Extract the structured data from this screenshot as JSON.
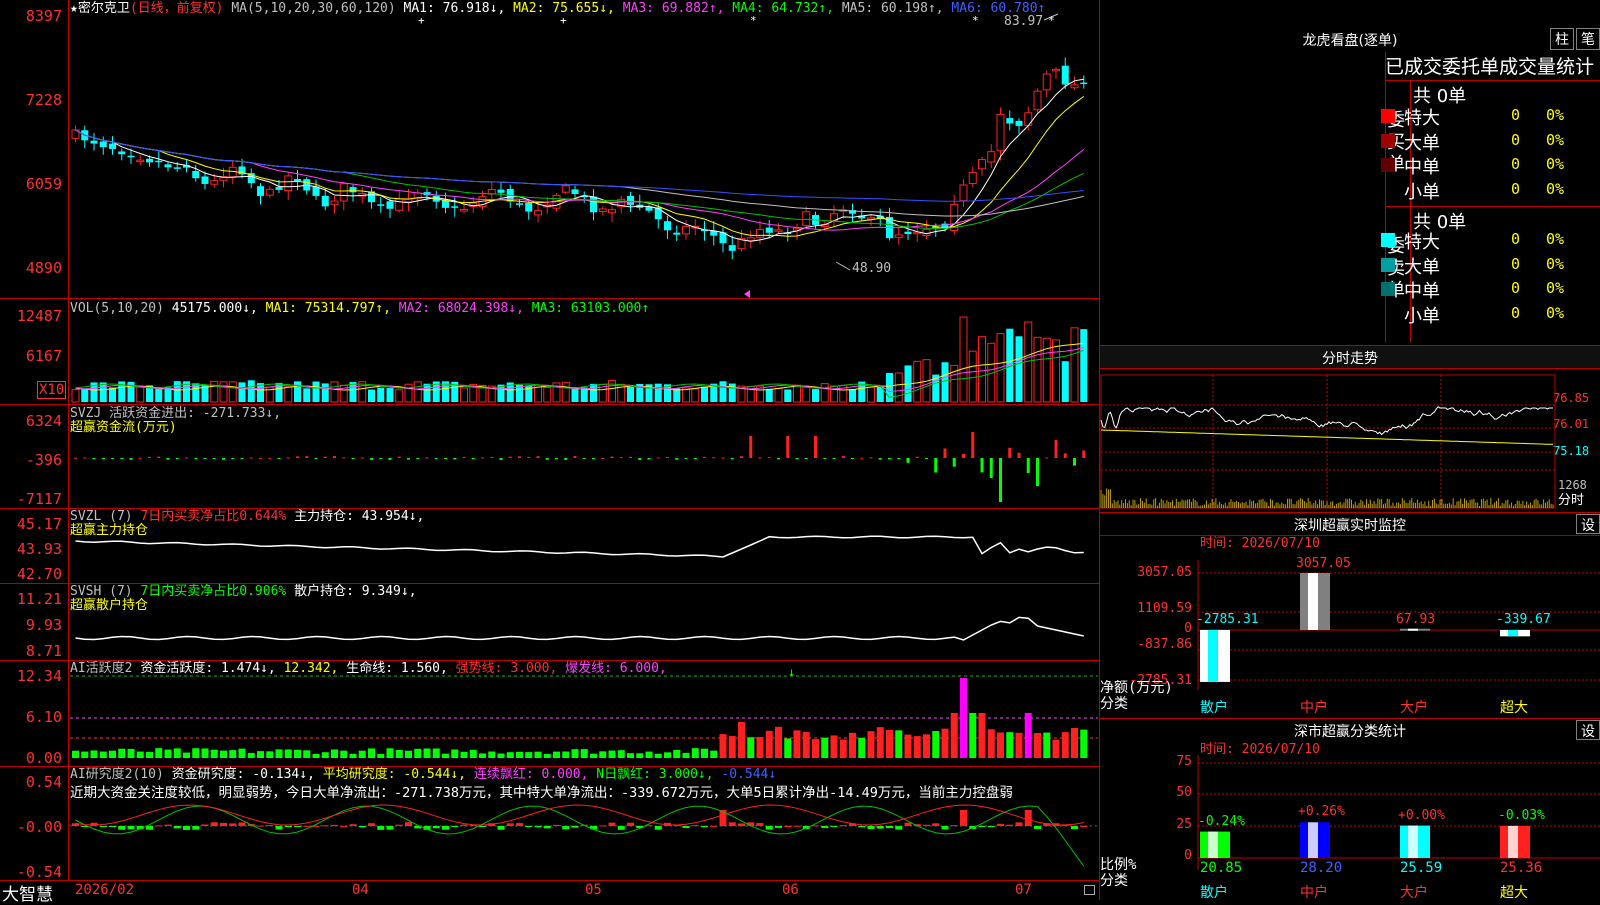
{
  "main": {
    "title_star": "★",
    "stock_name": "密尔克卫",
    "period": "(日线，前复权)",
    "ma_header": "MA(5,10,20,30,60,120)",
    "ma1": "MA1: 76.918↓,",
    "ma2": "MA2: 75.655↓,",
    "ma3": "MA3: 69.882↑,",
    "ma4": "MA4: 64.732↑,",
    "ma5": "MA5: 60.198↑,",
    "ma6": "MA6: 60.780↑",
    "price_axis": [
      "8397",
      "7228",
      "6059",
      "4890"
    ],
    "high_label": "83.97",
    "low_label": "48.90"
  },
  "vol": {
    "header": "VOL(5,10,20)",
    "v": "45175.000↓,",
    "ma1": "MA1: 75314.797↑,",
    "ma2": "MA2: 68024.398↓,",
    "ma3": "MA3: 63103.000↑",
    "axis": [
      "12487",
      "6167"
    ],
    "unit": "X10"
  },
  "svzj": {
    "header": "SVZJ  活跃资金进出: -271.733↓,",
    "sub": "超赢资金流(万元)",
    "axis": [
      "6324",
      "-396",
      "-7117"
    ]
  },
  "svzl": {
    "header1": "SVZL (7)",
    "header2": "7日内买卖净占比0.644%",
    "header3": "主力持仓: 43.954↓,",
    "sub": "超赢主力持仓",
    "axis": [
      "45.17",
      "43.93",
      "42.70"
    ]
  },
  "svsh": {
    "header1": "SVSH (7)",
    "header2": "7日内买卖净占比0.906%",
    "header3": "散户持仓: 9.349↓,",
    "sub": "超赢散户持仓",
    "axis": [
      "11.21",
      "9.93",
      "8.71"
    ]
  },
  "ai1": {
    "header1": "AI活跃度2",
    "header2": "资金活跃度: 1.474↓,",
    "header3": "12.342,",
    "header4": "生命线: 1.560,",
    "header5": "强势线: 3.000,",
    "header6": "爆发线: 6.000,",
    "axis": [
      "12.34",
      "6.10",
      "0.00"
    ]
  },
  "ai2": {
    "header1": "AI研究度2(10)",
    "header2": "资金研究度: -0.134↓,",
    "header3": "平均研究度: -0.544↓,",
    "header4": "连续飘红: 0.000,",
    "header5": "N日飘红: 3.000↓,",
    "header6": "-0.544↓",
    "comment": "近期大资金关注度较低，明显弱势，今日大单净流出：-271.738万元，其中特大单净流出：-339.672万元，大单5日累计净出-14.49万元，当前主力控盘弱",
    "axis": [
      "0.54",
      "-0.00",
      "-0.54"
    ]
  },
  "bottom": {
    "brand": "大智慧",
    "dates": [
      "2026/02",
      "04",
      "05",
      "06",
      "07"
    ]
  },
  "right": {
    "dragon_title": "龙虎看盘(逐单)",
    "btn_zhu": "柱",
    "btn_bi": "笔",
    "stats_title": "已成交委托单成交量统计",
    "buy_label": "委买单",
    "sell_label": "委卖单",
    "buy_total": "共 0单",
    "sell_total": "共 0单",
    "buy_rows": [
      {
        "name": "特大",
        "count": "0",
        "pct": "0%",
        "color": "#ff0000"
      },
      {
        "name": "大单",
        "count": "0",
        "pct": "0%",
        "color": "#a00000"
      },
      {
        "name": "中单",
        "count": "0",
        "pct": "0%",
        "color": "#600000"
      },
      {
        "name": "小单",
        "count": "0",
        "pct": "0%",
        "color": ""
      }
    ],
    "sell_rows": [
      {
        "name": "特大",
        "count": "0",
        "pct": "0%",
        "color": "#00ffff"
      },
      {
        "name": "大单",
        "count": "0",
        "pct": "0%",
        "color": "#00a0a0"
      },
      {
        "name": "中单",
        "count": "0",
        "pct": "0%",
        "color": "#007070"
      },
      {
        "name": "小单",
        "count": "0",
        "pct": "0%",
        "color": ""
      }
    ],
    "intraday_title": "分时走势",
    "intraday_axis": [
      "76.85",
      "76.01",
      "75.18"
    ],
    "intraday_vol": "1268",
    "intraday_unit": "分时",
    "monitor_title": "深圳超赢实时监控",
    "monitor_btn": "设",
    "monitor_time": "时间: 2026/07/10",
    "monitor_axis": [
      "3057.05",
      "1109.59",
      "0",
      "-837.86",
      "-2785.31"
    ],
    "monitor_ylabel1": "净额(万元)",
    "monitor_ylabel2": "分类",
    "monitor_bars": [
      {
        "cat": "散户",
        "value": "-2785.31",
        "num": -2785.31
      },
      {
        "cat": "中户",
        "value": "3057.05",
        "num": 3057.05
      },
      {
        "cat": "大户",
        "value": "67.93",
        "num": 67.93
      },
      {
        "cat": "超大",
        "value": "-339.67",
        "num": -339.67
      }
    ],
    "class_title": "深市超赢分类统计",
    "class_btn": "设",
    "class_time": "时间: 2026/07/10",
    "class_axis": [
      "75",
      "50",
      "25",
      "0"
    ],
    "class_ylabel1": "比例%",
    "class_ylabel2": "分类",
    "class_bars": [
      {
        "cat": "散户",
        "chg": "-0.24%",
        "value": "20.85",
        "num": 20.85,
        "color": "#00ff00"
      },
      {
        "cat": "中户",
        "chg": "+0.26%",
        "value": "28.20",
        "num": 28.2,
        "color": "#0000ff"
      },
      {
        "cat": "大户",
        "chg": "+0.00%",
        "value": "25.59",
        "num": 25.59,
        "color": "#00ffff"
      },
      {
        "cat": "超大",
        "chg": "-0.03%",
        "value": "25.36",
        "num": 25.36,
        "color": "#ff2020"
      }
    ]
  },
  "colors": {
    "up": "#ff2020",
    "down": "#00ffff",
    "axis": "#c00000"
  }
}
